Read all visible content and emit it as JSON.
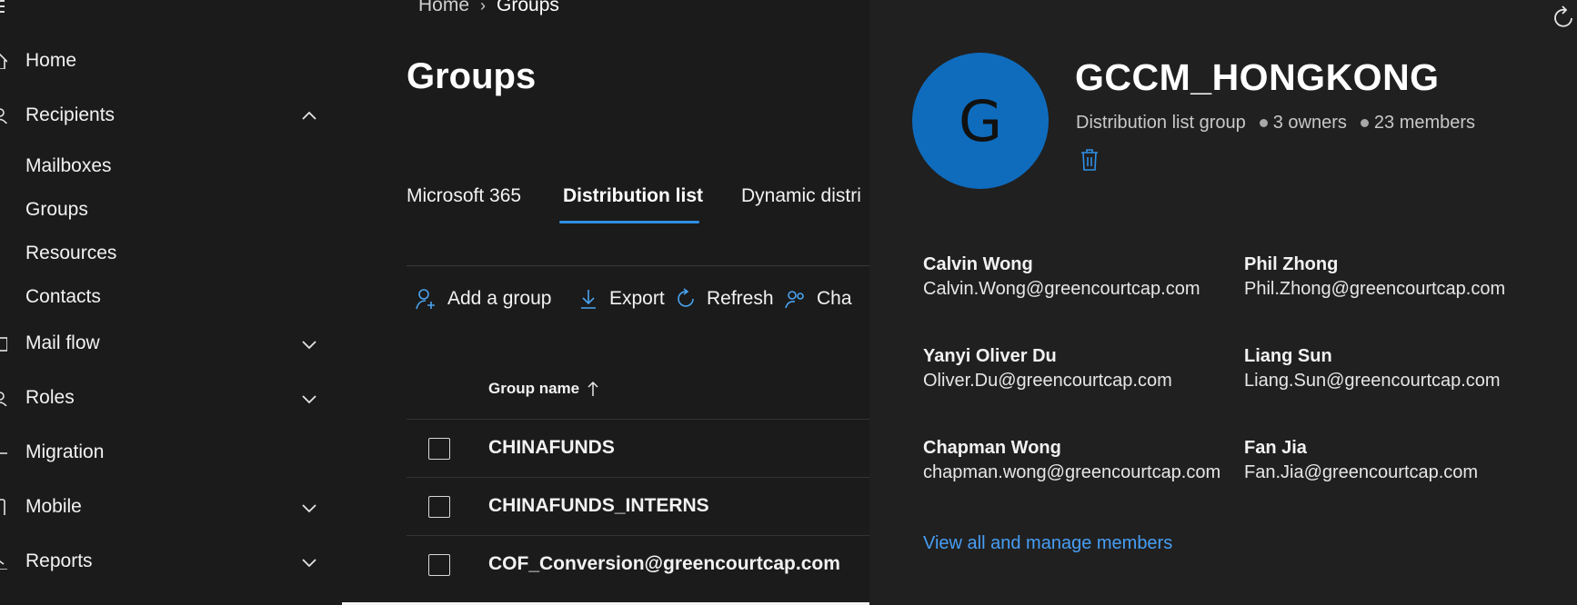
{
  "sidebar": {
    "items": [
      {
        "label": "Home",
        "icon": "home-icon",
        "expandable": false
      },
      {
        "label": "Recipients",
        "icon": "person-icon",
        "expandable": true,
        "expanded": true
      },
      {
        "label": "Mail flow",
        "icon": "mail-flow-icon",
        "expandable": true,
        "expanded": false
      },
      {
        "label": "Roles",
        "icon": "roles-icon",
        "expandable": true,
        "expanded": false
      },
      {
        "label": "Migration",
        "icon": "migration-icon",
        "expandable": false
      },
      {
        "label": "Mobile",
        "icon": "mobile-icon",
        "expandable": true,
        "expanded": false
      },
      {
        "label": "Reports",
        "icon": "reports-icon",
        "expandable": true,
        "expanded": false
      }
    ],
    "recipients_children": [
      "Mailboxes",
      "Groups",
      "Resources",
      "Contacts"
    ]
  },
  "breadcrumb": {
    "root": "Home",
    "current": "Groups"
  },
  "page": {
    "title": "Groups"
  },
  "tabs": [
    {
      "label": "Microsoft 365",
      "active": false
    },
    {
      "label": "Distribution list",
      "active": true
    },
    {
      "label": "Dynamic distri",
      "active": false
    }
  ],
  "toolbar": {
    "add_group": "Add a group",
    "export": "Export",
    "refresh": "Refresh",
    "change": "Cha"
  },
  "table": {
    "column_header": "Group name",
    "sort": "ascending",
    "rows": [
      {
        "name": "CHINAFUNDS"
      },
      {
        "name": "CHINAFUNDS_INTERNS"
      },
      {
        "name": "COF_Conversion@greencourtcap.com"
      }
    ]
  },
  "panel": {
    "avatar_letter": "G",
    "group_name": "GCCM_HONGKONG",
    "group_type": "Distribution list group",
    "owners": "3 owners",
    "members": "23 members",
    "member_list": [
      {
        "name": "Calvin Wong",
        "email": "Calvin.Wong@greencourtcap.com"
      },
      {
        "name": "Phil Zhong",
        "email": "Phil.Zhong@greencourtcap.com"
      },
      {
        "name": "Yanyi Oliver Du",
        "email": "Oliver.Du@greencourtcap.com"
      },
      {
        "name": "Liang Sun",
        "email": "Liang.Sun@greencourtcap.com"
      },
      {
        "name": "Chapman Wong",
        "email": "chapman.wong@greencourtcap.com"
      },
      {
        "name": "Fan Jia",
        "email": "Fan.Jia@greencourtcap.com"
      }
    ],
    "manage_link": "View all and manage members"
  },
  "colors": {
    "background": "#1b1b1b",
    "panel": "#202020",
    "accent": "#2f8fe5",
    "avatar": "#0f6cbd",
    "link": "#479ef5"
  }
}
